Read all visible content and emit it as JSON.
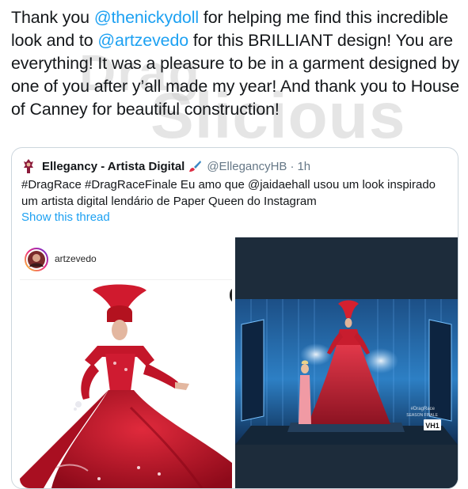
{
  "tweet": {
    "parts": [
      {
        "text": "Thank you ",
        "mention": false
      },
      {
        "text": "@thenickydoll",
        "mention": true
      },
      {
        "text": " for helping me find this incredible look and to ",
        "mention": false
      },
      {
        "text": "@artzevedo",
        "mention": true
      },
      {
        "text": " for this BRILLIANT design! You are everything! It was a pleasure to be in a garment designed by one of you after y’all made my year! And thank you to House of Canney for beautiful construction!",
        "mention": false
      }
    ]
  },
  "watermark": {
    "text_top": "Drag",
    "text_bottom": "Slicious"
  },
  "quote": {
    "name": "Ellegancy - Artista Digital",
    "handle": "@EllegancyHB",
    "separator": "·",
    "time": "1h",
    "body": "#DragRace #DragRaceFinale Eu amo que @jaidaehall usou um look inspirado um artista digital lendário de Paper Queen do Instagram",
    "show_thread": "Show this thread"
  },
  "media_left": {
    "username": "artzevedo"
  },
  "media_right": {
    "broadcast_text_1": "#DragRace",
    "broadcast_text_2": "SEASON FINALE",
    "network_logo": "VH1"
  },
  "colors": {
    "link": "#1da1f2",
    "text": "#14171a",
    "muted": "#657786",
    "border": "#ccd6dd",
    "gown_red": "#c8102e",
    "stage_blue": "#1f6fb8"
  }
}
